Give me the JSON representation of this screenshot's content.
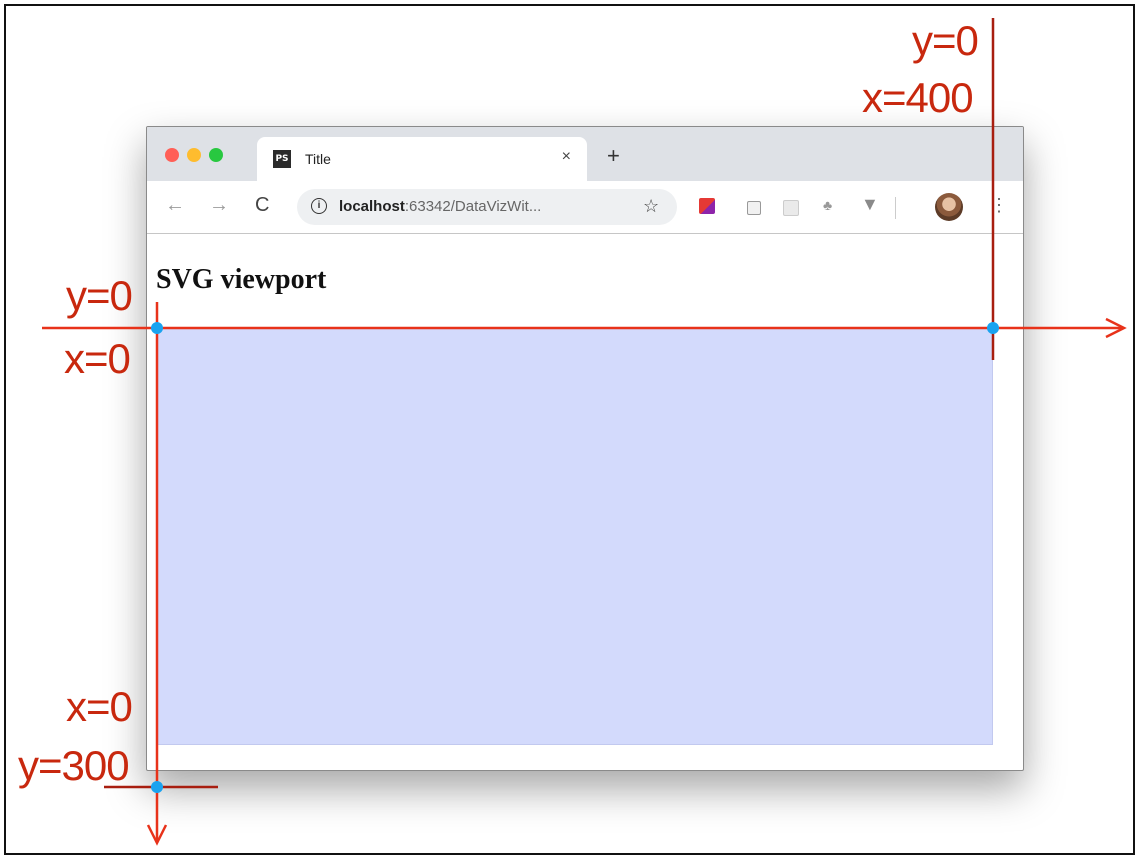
{
  "browser": {
    "tab_title": "Title",
    "tab_favicon_text": "PS",
    "tab_close": "×",
    "new_tab": "+",
    "url_host": "localhost",
    "url_rest": ":63342/DataVizWit...",
    "icons": [
      "back-arrow",
      "forward-arrow",
      "reload",
      "info",
      "star",
      "extension",
      "avatar",
      "menu"
    ]
  },
  "page": {
    "heading": "SVG viewport",
    "viewport_fill": "#d3dafc"
  },
  "annotations": {
    "color": "#c8280e",
    "point_color": "#1aa3f0",
    "top_right_y": "y=0",
    "top_right_x": "x=400",
    "origin_y": "y=0",
    "origin_x": "x=0",
    "bottom_left_x": "x=0",
    "bottom_left_y": "y=300"
  }
}
